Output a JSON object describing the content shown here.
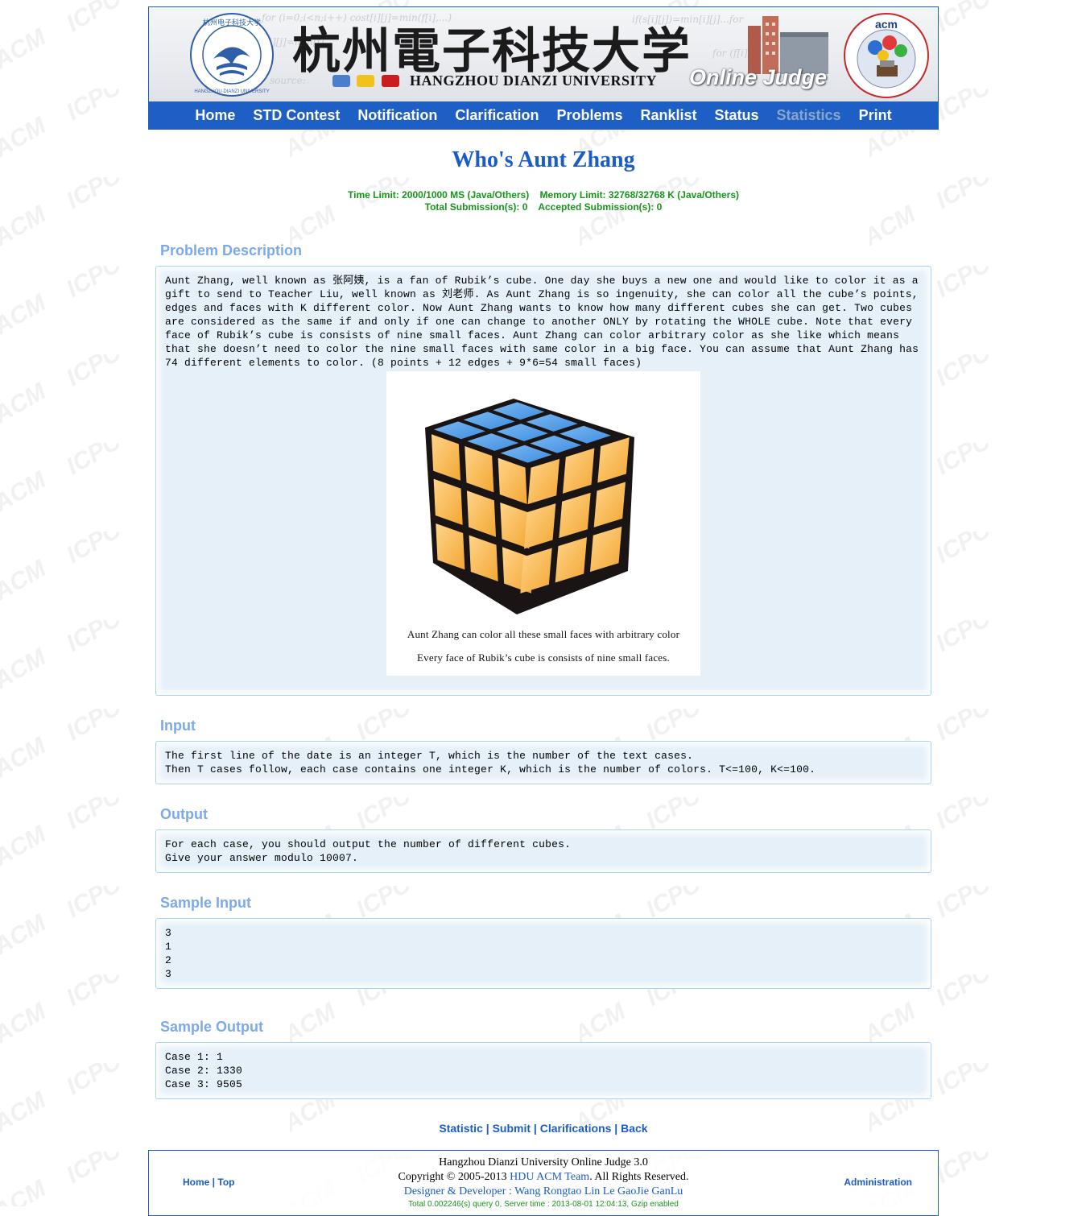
{
  "header": {
    "chinese_title": "杭州電子科技大学",
    "university_name": "HANGZHOU DIANZI UNIVERSITY",
    "product_name": "Online Judge"
  },
  "nav": {
    "items": [
      {
        "label": "Home"
      },
      {
        "label": "STD Contest"
      },
      {
        "label": "Notification"
      },
      {
        "label": "Clarification"
      },
      {
        "label": "Problems"
      },
      {
        "label": "Ranklist"
      },
      {
        "label": "Status"
      },
      {
        "label": "Statistics",
        "active": true
      },
      {
        "label": "Print"
      }
    ]
  },
  "problem": {
    "title": "Who's Aunt Zhang",
    "limits_line1": "Time Limit: 2000/1000 MS (Java/Others)    Memory Limit: 32768/32768 K (Java/Others)",
    "limits_line2": "Total Submission(s): 0    Accepted Submission(s): 0",
    "description_heading": "Problem Description",
    "description_text": "Aunt Zhang, well known as 张阿姨, is a fan of Rubik’s cube. One day she buys a new one and would like to color it as a gift to send to Teacher Liu, well known as 刘老师. As Aunt Zhang is so ingenuity, she can color all the cube’s points, edges and faces with K different color. Now Aunt Zhang wants to know how many different cubes she can get. Two cubes are considered as the same if and only if one can change to another ONLY by rotating the WHOLE cube. Note that every face of Rubik’s cube is consists of nine small faces. Aunt Zhang can color arbitrary color as she like which means that she doesn’t need to color the nine small faces with same color in a big face. You can assume that Aunt Zhang has 74 different elements to color. (8 points + 12 edges + 9*6=54 small faces)",
    "figure_caption_1": "Aunt Zhang can color all these small faces with arbitrary color",
    "figure_caption_2": "Every face of Rubik’s cube is consists of nine small faces.",
    "input_heading": "Input",
    "input_text": "The first line of the date is an integer T, which is the number of the text cases.\nThen T cases follow, each case contains one integer K, which is the number of colors. T<=100, K<=100.",
    "output_heading": "Output",
    "output_text": "For each case, you should output the number of different cubes.\nGive your answer modulo 10007.",
    "sample_input_heading": "Sample Input",
    "sample_input_text": "3\n1\n2\n3",
    "sample_output_heading": "Sample Output",
    "sample_output_text": "Case 1: 1\nCase 2: 1330\nCase 3: 9505"
  },
  "actions": {
    "statistic": "Statistic",
    "submit": "Submit",
    "clarifications": "Clarifications",
    "back": "Back",
    "separator": " | "
  },
  "footer": {
    "home": "Home",
    "top": "Top",
    "nav_sep": " | ",
    "line1": "Hangzhou Dianzi University Online Judge 3.0",
    "copyright_prefix": "Copyright © 2005-2013 ",
    "team": "HDU ACM Team",
    "copyright_suffix": ". All Rights Reserved.",
    "designer_label": "Designer & Developer",
    "designer_sep": " : ",
    "designers": "Wang Rongtao Lin Le GaoJie GanLu",
    "server_line": "Total 0.002246(s) query 0, Server time : 2013-08-01 12:04:13, Gzip enabled",
    "administration": "Administration"
  },
  "colors": {
    "nav_blue": "#1d5fc4",
    "title_blue": "#1a5cc8",
    "section_heading": "#7ca9e8",
    "limits_green": "#18941c",
    "panel_bg": "#e5f0f9",
    "panel_border": "#a9d4f3"
  }
}
